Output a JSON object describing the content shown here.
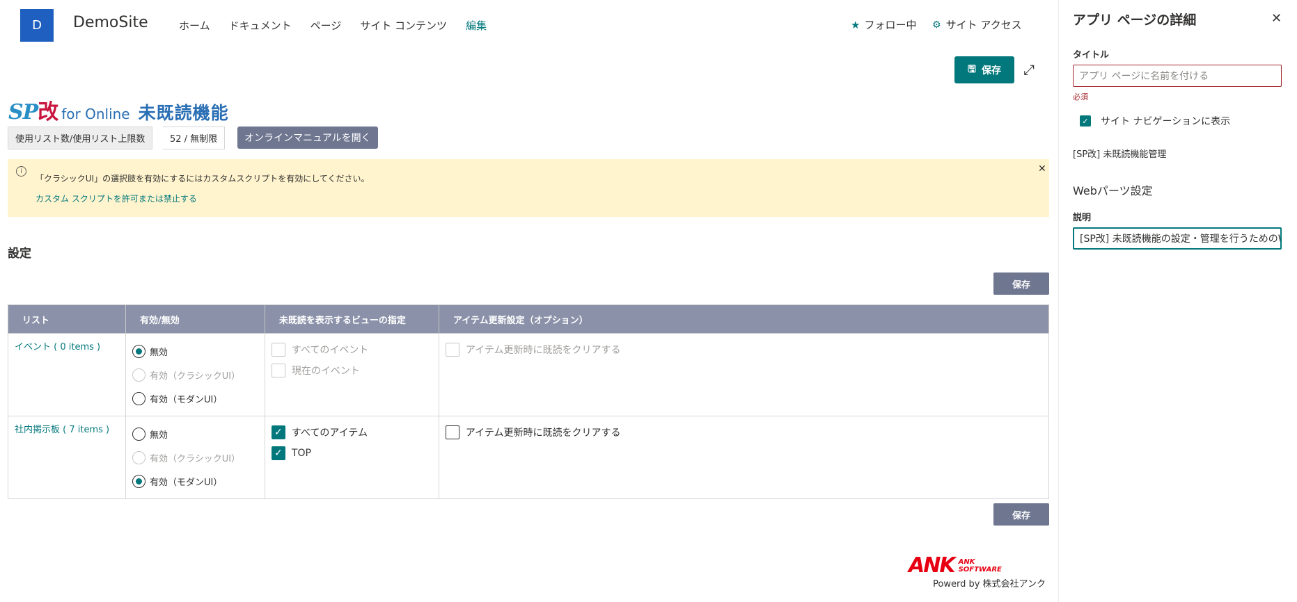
{
  "header": {
    "logo_letter": "D",
    "site_name": "DemoSite",
    "nav": [
      "ホーム",
      "ドキュメント",
      "ページ",
      "サイト コンテンツ",
      "編集"
    ],
    "follow_label": "フォロー中",
    "access_label": "サイト アクセス",
    "save_label": "保存"
  },
  "brand": {
    "sp": "SP",
    "kai": "改",
    "online": "for Online",
    "feature": "未既読機能"
  },
  "usage": {
    "label": "使用リスト数/使用リスト上限数",
    "value": "52 / 無制限",
    "manual_button": "オンラインマニュアルを開く"
  },
  "banner": {
    "message": "「クラシックUI」の選択肢を有効にするにはカスタムスクリプトを有効にしてください。",
    "link": "カスタム スクリプトを許可または禁止する"
  },
  "settings": {
    "title": "設定",
    "save_label": "保存",
    "columns": [
      "リスト",
      "有効/無効",
      "未既読を表示するビューの指定",
      "アイテム更新設定（オプション）"
    ],
    "rows": [
      {
        "list": "イベント ( 0 items )",
        "options": [
          "無効",
          "有効（クラシックUI）",
          "有効（モダンUI）"
        ],
        "selected": 0,
        "views": [
          "すべてのイベント",
          "現在のイベント"
        ],
        "views_checked": [
          false,
          false
        ],
        "clear_label": "アイテム更新時に既読をクリアする",
        "clear_checked": false
      },
      {
        "list": "社内掲示板 ( 7 items )",
        "options": [
          "無効",
          "有効（クラシックUI）",
          "有効（モダンUI）"
        ],
        "selected": 2,
        "views": [
          "すべてのアイテム",
          "TOP"
        ],
        "views_checked": [
          true,
          true
        ],
        "clear_label": "アイテム更新時に既読をクリアする",
        "clear_checked": false
      }
    ]
  },
  "footer": {
    "logo_big": "ANK",
    "logo_small_1": "ANK",
    "logo_small_2": "SOFTWARE",
    "powered": "Powerd by 株式会社アンク"
  },
  "panel": {
    "title": "アプリ ページの詳細",
    "title_label": "タイトル",
    "title_placeholder": "アプリ ページに名前を付ける",
    "required": "必須",
    "show_in_nav": "サイト ナビゲーションに表示",
    "app_name": "[SP改] 未既読機能管理",
    "webpart_settings": "Webパーツ設定",
    "desc_label": "説明",
    "desc_value": "[SP改] 未既読機能の設定・管理を行うためのWebパーツです。"
  },
  "colors": {
    "accent": "#03787c",
    "header_bg": "#8a91a8",
    "button_grey": "#6e7690",
    "banner_bg": "#fff4ce",
    "ank_red": "#e60012"
  }
}
